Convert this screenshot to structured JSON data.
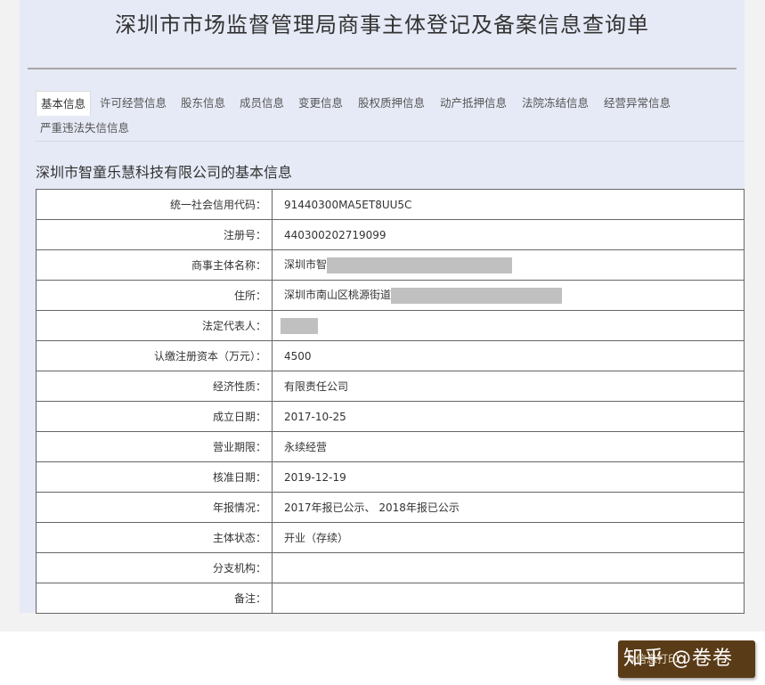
{
  "header": {
    "title": "深圳市市场监督管理局商事主体登记及备案信息查询单"
  },
  "tabs": [
    {
      "label": "基本信息",
      "active": true
    },
    {
      "label": "许可经营信息"
    },
    {
      "label": "股东信息"
    },
    {
      "label": "成员信息"
    },
    {
      "label": "变更信息"
    },
    {
      "label": "股权质押信息"
    },
    {
      "label": "动产抵押信息"
    },
    {
      "label": "法院冻结信息"
    },
    {
      "label": "经营异常信息"
    },
    {
      "label": "严重违法失信信息"
    }
  ],
  "section": {
    "title": "深圳市智童乐慧科技有限公司的基本信息"
  },
  "rows": [
    {
      "label": "统一社会信用代码：",
      "value": "91440300MA5ET8UU5C"
    },
    {
      "label": "注册号：",
      "value": "440300202719099"
    },
    {
      "label": "商事主体名称：",
      "value": "深圳市智"
    },
    {
      "label": "住所：",
      "value": "深圳市南山区桃源街道"
    },
    {
      "label": "法定代表人：",
      "value": ""
    },
    {
      "label": "认缴注册资本（万元）：",
      "value": "4500"
    },
    {
      "label": "经济性质：",
      "value": "有限责任公司"
    },
    {
      "label": "成立日期：",
      "value": "2017-10-25"
    },
    {
      "label": "营业期限：",
      "value": "永续经营"
    },
    {
      "label": "核准日期：",
      "value": "2019-12-19"
    },
    {
      "label": "年报情况：",
      "value": "2017年报已公示、 2018年报已公示"
    },
    {
      "label": "主体状态：",
      "value": "开业（存续）"
    },
    {
      "label": "分支机构：",
      "value": ""
    },
    {
      "label": "备注：",
      "value": ""
    }
  ],
  "watermark": {
    "print_label": "信息打印",
    "overlay_text": "知乎 @卷卷",
    "icon": "pencil-icon"
  }
}
